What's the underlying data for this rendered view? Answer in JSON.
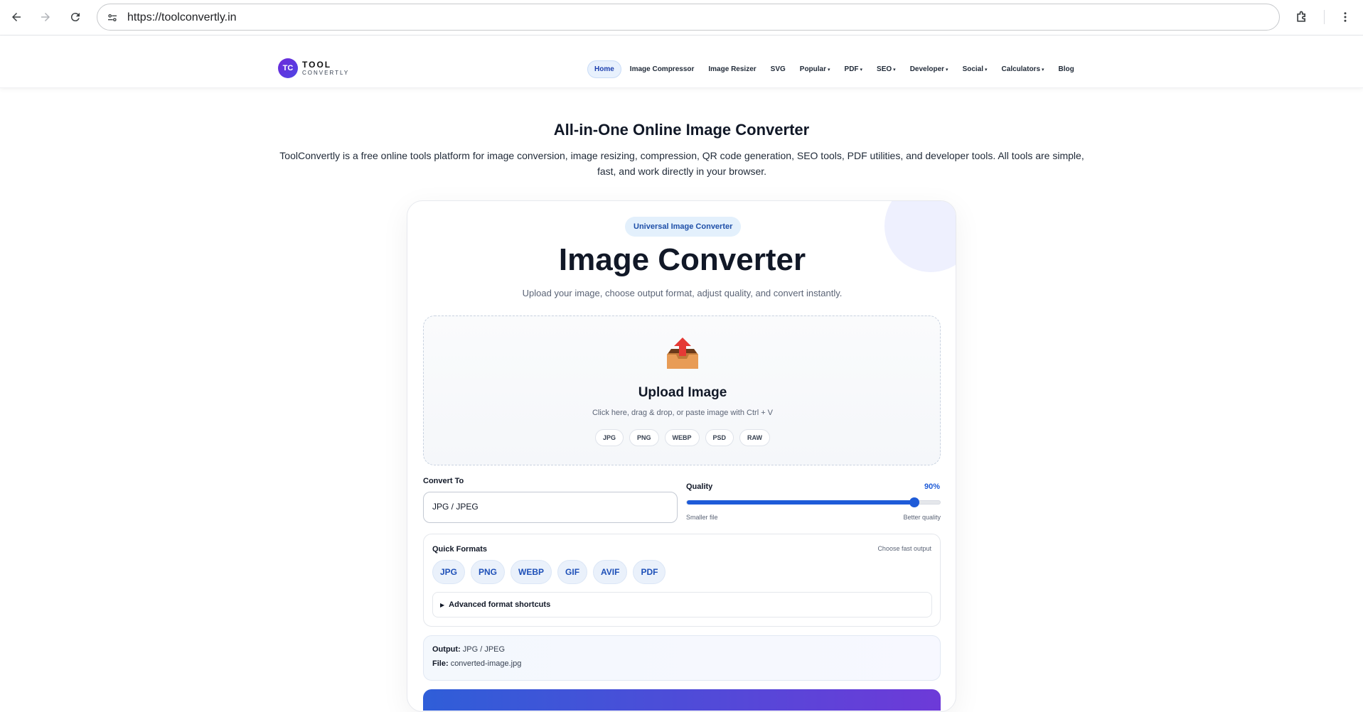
{
  "browser": {
    "url": "https://toolconvertly.in",
    "stray_char": "\\"
  },
  "header": {
    "logo_mark": "TC",
    "logo_line1": "TOOL",
    "logo_line2": "CONVERTLY",
    "nav": [
      {
        "label": "Home",
        "active": true,
        "dropdown": false
      },
      {
        "label": "Image Compressor",
        "dropdown": false
      },
      {
        "label": "Image Resizer",
        "dropdown": false
      },
      {
        "label": "SVG",
        "dropdown": false
      },
      {
        "label": "Popular",
        "dropdown": true
      },
      {
        "label": "PDF",
        "dropdown": true
      },
      {
        "label": "SEO",
        "dropdown": true
      },
      {
        "label": "Developer",
        "dropdown": true
      },
      {
        "label": "Social",
        "dropdown": true
      },
      {
        "label": "Calculators",
        "dropdown": true
      },
      {
        "label": "Blog",
        "dropdown": false
      }
    ],
    "caret": "▾"
  },
  "hero": {
    "title": "All-in-One Online Image Converter",
    "description": "ToolConvertly is a free online tools platform for image conversion, image resizing, compression, QR code generation, SEO tools, PDF utilities, and developer tools. All tools are simple, fast, and work directly in your browser."
  },
  "card": {
    "badge": "Universal Image Converter",
    "title": "Image Converter",
    "subtitle": "Upload your image, choose output format, adjust quality, and convert instantly.",
    "upload": {
      "title": "Upload Image",
      "hint": "Click here, drag & drop, or paste image with Ctrl + V",
      "formats": [
        "JPG",
        "PNG",
        "WEBP",
        "PSD",
        "RAW"
      ]
    },
    "convert_to": {
      "label": "Convert To",
      "value": "JPG / JPEG"
    },
    "quality": {
      "label": "Quality",
      "value_text": "90%",
      "value": 0.9,
      "min_label": "Smaller file",
      "max_label": "Better quality"
    },
    "quick_formats": {
      "title": "Quick Formats",
      "hint": "Choose fast output",
      "buttons": [
        "JPG",
        "PNG",
        "WEBP",
        "GIF",
        "AVIF",
        "PDF"
      ],
      "advanced_label": "Advanced format shortcuts",
      "advanced_marker": "▶"
    },
    "output": {
      "output_label": "Output:",
      "output_value": "JPG / JPEG",
      "file_label": "File:",
      "file_value": "converted-image.jpg"
    }
  },
  "colors": {
    "accent": "#1e5bd8",
    "brand_purple": "#6d28d9"
  }
}
